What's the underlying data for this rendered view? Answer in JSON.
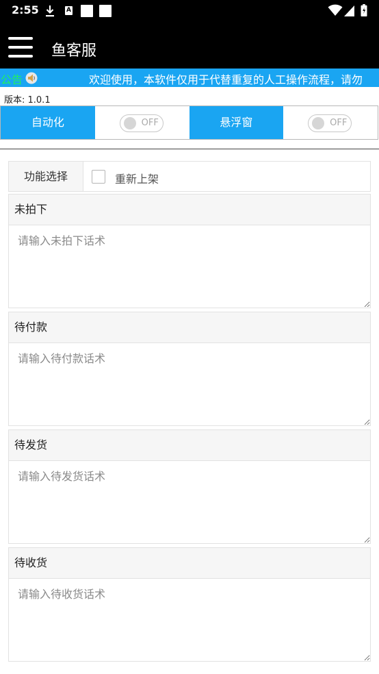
{
  "status_bar": {
    "time": "2:55",
    "icons": [
      "download-icon",
      "a-box-icon",
      "white-square-icon",
      "white-square-icon",
      "wifi-icon",
      "signal-icon",
      "battery-icon"
    ],
    "a_glyph": "A"
  },
  "app_bar": {
    "title": "鱼客服",
    "menu_icon": "hamburger-menu-icon"
  },
  "notice": {
    "label": "公告",
    "icon": "speaker-icon",
    "text": "欢迎使用，本软件仅用于代替重复的人工操作流程，请勿"
  },
  "version": "版本: 1.0.1",
  "toggles": [
    {
      "label": "自动化",
      "state": "OFF"
    },
    {
      "label": "悬浮窗",
      "state": "OFF"
    }
  ],
  "function_select": {
    "label": "功能选择",
    "option": "重新上架",
    "checked": false
  },
  "sections": [
    {
      "title": "未拍下",
      "placeholder": "请输入未拍下话术"
    },
    {
      "title": "待付款",
      "placeholder": "请输入待付款话术"
    },
    {
      "title": "待发货",
      "placeholder": "请输入待发货话术"
    },
    {
      "title": "待收货",
      "placeholder": "请输入待收货话术"
    }
  ],
  "colors": {
    "accent_blue": "#1aa5f2",
    "notice_label_green": "#20f060",
    "bar_black": "#000000",
    "switch_off_gray": "#aaaaaa"
  }
}
